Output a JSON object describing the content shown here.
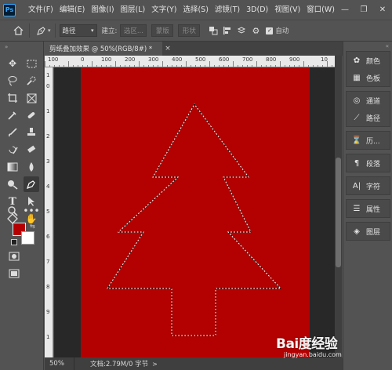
{
  "app": {
    "logo_text": "Ps",
    "menu": [
      "文件(F)",
      "编辑(E)",
      "图像(I)",
      "图层(L)",
      "文字(Y)",
      "选择(S)",
      "滤镜(T)",
      "3D(D)",
      "视图(V)",
      "窗口(W)"
    ],
    "window_controls": {
      "minimize": "—",
      "restore": "❐",
      "close": "✕"
    }
  },
  "options_bar": {
    "mode_select": "路径",
    "build_label": "建立:",
    "selection_button": "选区...",
    "mask_button": "蒙版",
    "shape_button": "形状",
    "auto_add_label": "自动"
  },
  "document": {
    "tab_title": "剪纸叠加效果 @ 50%(RGB/8#) *",
    "tab_close": "×",
    "canvas_color": "#b30000",
    "ruler_top_labels": [
      "100",
      "0",
      "100",
      "200",
      "300",
      "400",
      "500",
      "600",
      "700",
      "800",
      "900",
      "10"
    ],
    "ruler_left_labels": [
      "1",
      "0",
      "1",
      "2",
      "3",
      "4",
      "5",
      "6",
      "7",
      "8",
      "9",
      "1"
    ]
  },
  "status_bar": {
    "zoom": "50%",
    "doc_info": "文档:2.79M/0 字节",
    "arrow": ">"
  },
  "colors": {
    "foreground": "#b40000",
    "background": "#ffffff",
    "ui_dark": "#535353"
  },
  "panels": [
    {
      "items": [
        {
          "icon": "color-palette-icon",
          "glyph": "✿",
          "label": "颜色"
        },
        {
          "icon": "swatches-icon",
          "glyph": "▦",
          "label": "色板"
        }
      ]
    },
    {
      "items": [
        {
          "icon": "channels-icon",
          "glyph": "◎",
          "label": "通道"
        },
        {
          "icon": "paths-icon",
          "glyph": "⟋",
          "label": "路径"
        }
      ]
    },
    {
      "items": [
        {
          "icon": "history-icon",
          "glyph": "⌛",
          "label": "历..."
        }
      ]
    },
    {
      "items": [
        {
          "icon": "paragraph-icon",
          "glyph": "¶",
          "label": "段落"
        }
      ]
    },
    {
      "items": [
        {
          "icon": "character-icon",
          "glyph": "A|",
          "label": "字符"
        }
      ]
    },
    {
      "items": [
        {
          "icon": "properties-icon",
          "glyph": "☰",
          "label": "属性"
        }
      ]
    },
    {
      "items": [
        {
          "icon": "layers-icon",
          "glyph": "◈",
          "label": "图层"
        }
      ]
    }
  ],
  "watermark": {
    "logo": "Bai度经验",
    "sub": "jingyan.baidu.com"
  }
}
